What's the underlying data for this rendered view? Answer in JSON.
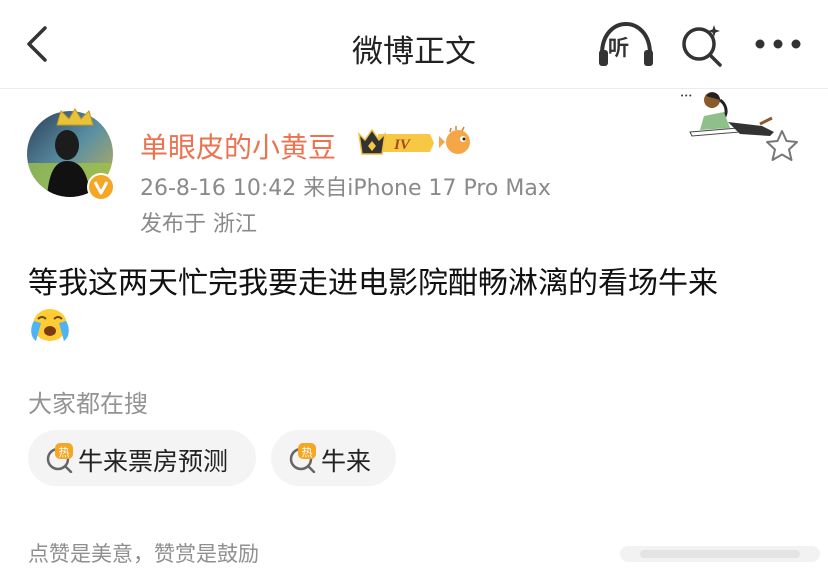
{
  "nav": {
    "title": "微博正文",
    "listen_label": "听"
  },
  "post": {
    "username": "单眼皮的小黄豆",
    "vip_level": "IV",
    "time_source": "26-8-16 10:42  来自iPhone 17 Pro Max",
    "location": "发布于 浙江",
    "text": "等我这两天忙完我要走进电影院酣畅淋漓的看场牛来"
  },
  "hot_search": {
    "label": "大家都在搜",
    "hot_badge": "热",
    "chips": [
      {
        "label": "牛来票房预测"
      },
      {
        "label": "牛来"
      }
    ]
  },
  "footer": {
    "like_text": "点赞是美意，赞赏是鼓励"
  },
  "colors": {
    "username": "#eb7350",
    "meta": "#8a8a8a",
    "chip_bg": "#f4f4f4",
    "hot_icon": "#f5a623"
  }
}
